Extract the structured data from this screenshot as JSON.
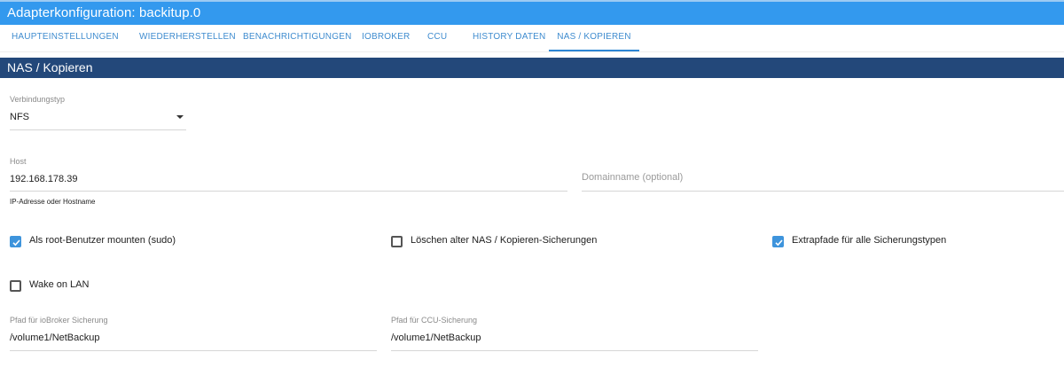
{
  "window": {
    "title": "Adapterkonfiguration: backitup.0"
  },
  "tabs": [
    {
      "label": "HAUPTEINSTELLUNGEN"
    },
    {
      "label": "WIEDERHERSTELLEN"
    },
    {
      "label": "BENACHRICHTIGUNGEN"
    },
    {
      "label": "IOBROKER"
    },
    {
      "label": "CCU"
    },
    {
      "label": "HISTORY DATEN"
    },
    {
      "label": "NAS / KOPIEREN",
      "active": true
    }
  ],
  "section": {
    "title": "NAS / Kopieren"
  },
  "form": {
    "connection_type": {
      "label": "Verbindungstyp",
      "value": "NFS"
    },
    "host": {
      "label": "Host",
      "value": "192.168.178.39",
      "helper": "IP-Adresse oder Hostname"
    },
    "domain": {
      "placeholder": "Domainname (optional)"
    },
    "checkboxes": {
      "root_mount": {
        "label": "Als root-Benutzer mounten (sudo)",
        "checked": true
      },
      "delete_old": {
        "label": "Löschen alter NAS / Kopieren-Sicherungen",
        "checked": false
      },
      "extra_paths": {
        "label": "Extrapfade für alle Sicherungstypen",
        "checked": true
      },
      "wake_on_lan": {
        "label": "Wake on LAN",
        "checked": false
      }
    },
    "iobroker_path": {
      "label": "Pfad für ioBroker Sicherung",
      "value": "/volume1/NetBackup"
    },
    "ccu_path": {
      "label": "Pfad für CCU-Sicherung",
      "value": "/volume1/NetBackup"
    }
  },
  "colors": {
    "titlebar": "#3399ee",
    "section_header": "#23487a",
    "tab_text": "#3f8ccf",
    "checkbox_checked": "#3e94dc"
  },
  "icons": {
    "dropdown": "caret-down-icon",
    "checkmark": "checkmark-icon"
  }
}
